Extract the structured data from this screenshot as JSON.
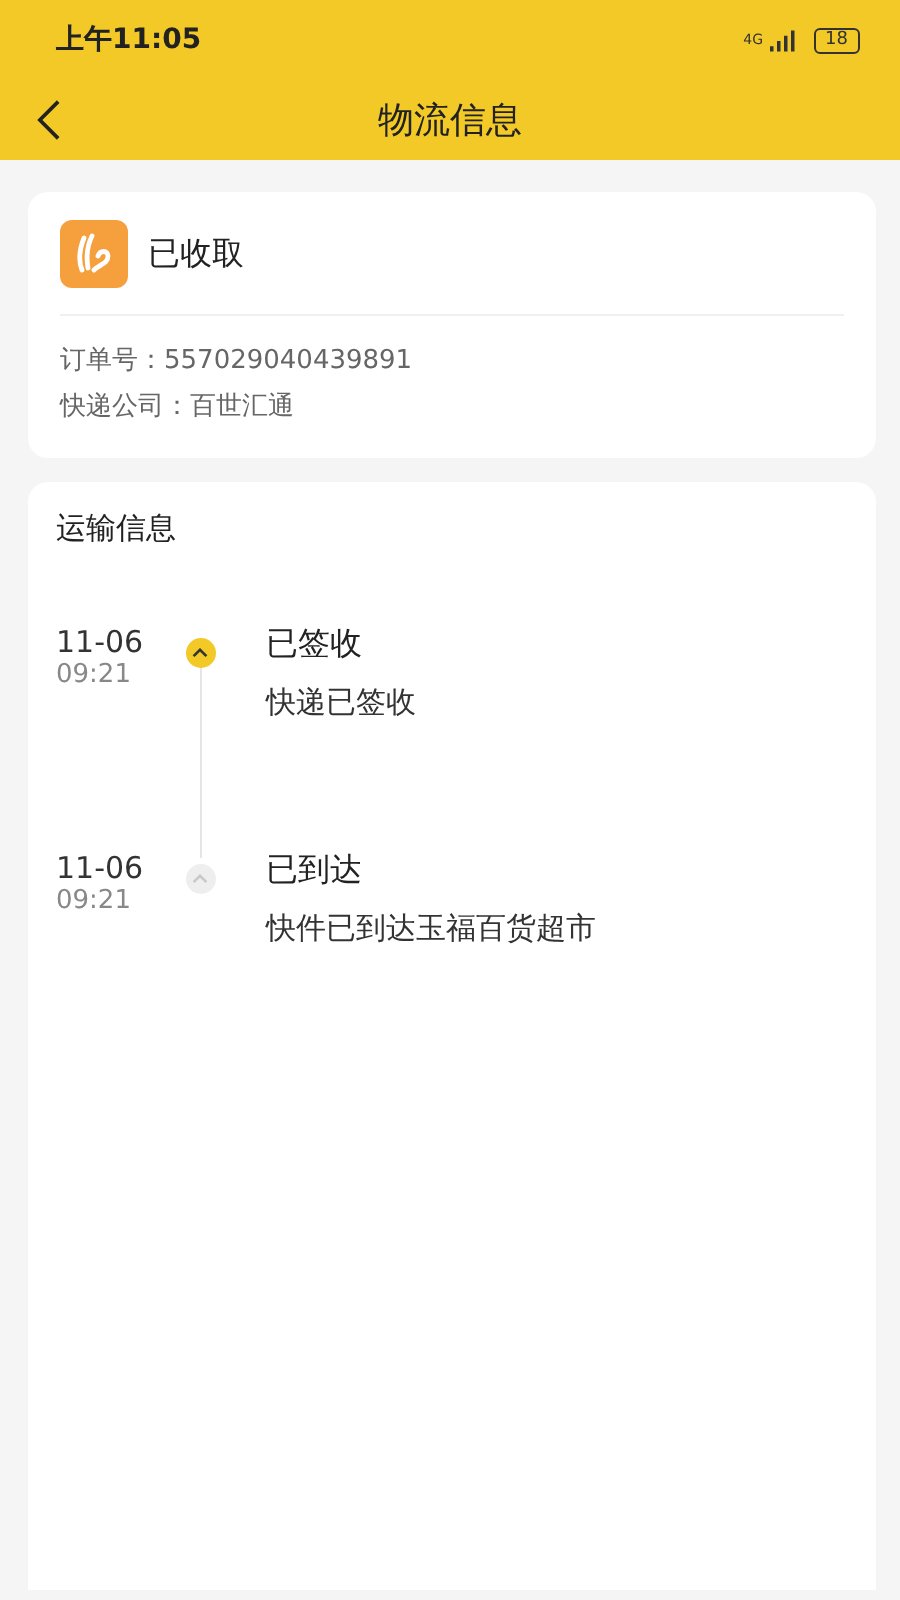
{
  "status_bar": {
    "time": "上午11:05",
    "network": "4G",
    "battery": "18"
  },
  "header": {
    "title": "物流信息"
  },
  "package": {
    "status": "已收取",
    "fields": [
      {
        "label": "订单号：",
        "value": "557029040439891"
      },
      {
        "label": "快递公司：",
        "value": "百世汇通"
      }
    ]
  },
  "tracking": {
    "title": "运输信息",
    "events": [
      {
        "date": "11-06",
        "time": "09:21",
        "title": "已签收",
        "detail": "快递已签收",
        "current": true
      },
      {
        "date": "11-06",
        "time": "09:21",
        "title": "已到达",
        "detail": "快件已到达玉福百货超市",
        "current": false
      }
    ]
  }
}
